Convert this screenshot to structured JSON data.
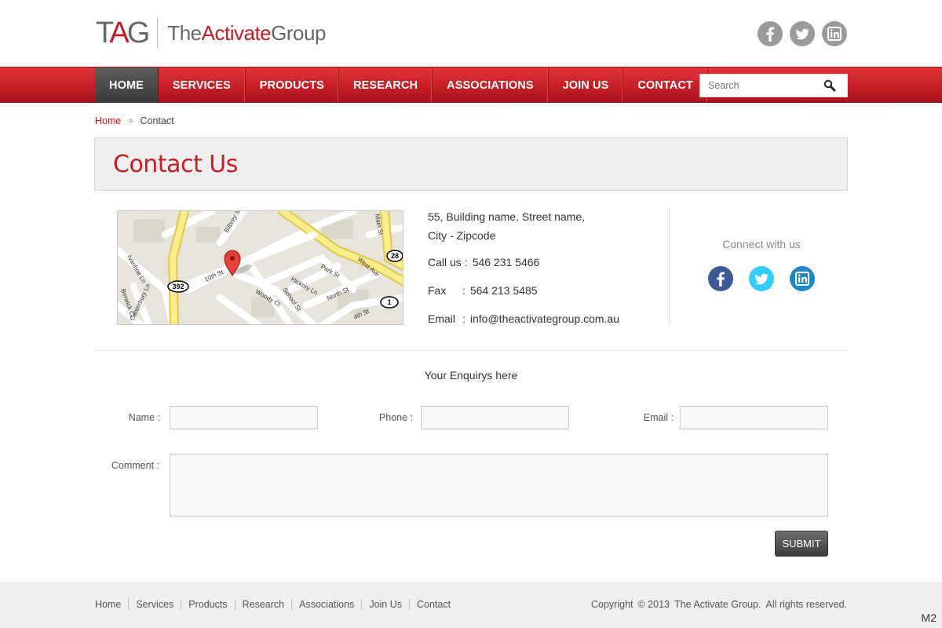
{
  "header": {
    "logo_mark_a": "T",
    "logo_mark_b": "A",
    "logo_mark_c": "G",
    "logo_text_a": "The",
    "logo_text_b": "Activate",
    "logo_text_c": "Group",
    "social": [
      {
        "icon": "facebook-icon",
        "glyph": "f"
      },
      {
        "icon": "twitter-icon",
        "glyph": "t"
      },
      {
        "icon": "linkedin-icon",
        "glyph": "in"
      }
    ]
  },
  "nav": {
    "items": [
      "HOME",
      "SERVICES",
      "PRODUCTS",
      "RESEARCH",
      "ASSOCIATIONS",
      "JOIN US",
      "CONTACT"
    ],
    "active_index": 0,
    "search_placeholder": "Search",
    "search_icon": "search-icon"
  },
  "breadcrumb": {
    "home": "Home",
    "separator": "»",
    "current": "Contact"
  },
  "page_title": "Contact Us",
  "map": {
    "labels": [
      "10th St",
      "Hickory Ln",
      "Park St",
      "West Ave",
      "Main St",
      "Woody Ct",
      "School St",
      "North St",
      "4th St",
      "Ivanhoe Ln",
      "Berwick Ct",
      "Canterbury Ln",
      "Bilbrey St",
      "392",
      "28",
      "1"
    ]
  },
  "contact": {
    "address_line1": "55, Building name, Street name,",
    "address_line2": "City - Zipcode",
    "call_label": "Call us",
    "call_value": "546 231 5466",
    "fax_label": "Fax",
    "fax_value": "564 213 5485",
    "email_label": "Email",
    "email_value": "info@theactivategroup.com.au",
    "colon": ":"
  },
  "connect": {
    "title": "Connect with us",
    "colors": {
      "facebook": "#3b5998",
      "twitter": "#33ccff",
      "linkedin": "#1e88c7"
    }
  },
  "form": {
    "title": "Your Enquirys here",
    "name_label": "Name :",
    "phone_label": "Phone :",
    "email_label": "Email :",
    "comment_label": "Comment :",
    "submit_label": "SUBMIT"
  },
  "footer": {
    "links": [
      "Home",
      "Services",
      "Products",
      "Research",
      "Associations",
      "Join Us",
      "Contact"
    ],
    "copyright_a": "Copyright",
    "copyright_b": "© 2013",
    "copyright_c": "The Activate Group.",
    "copyright_d": "All rights reserved.",
    "corner_tag": "M2"
  },
  "colors": {
    "brand_red": "#c41e25",
    "nav_active": "#3b3b3b",
    "gray_icon": "#9a9a9a"
  }
}
